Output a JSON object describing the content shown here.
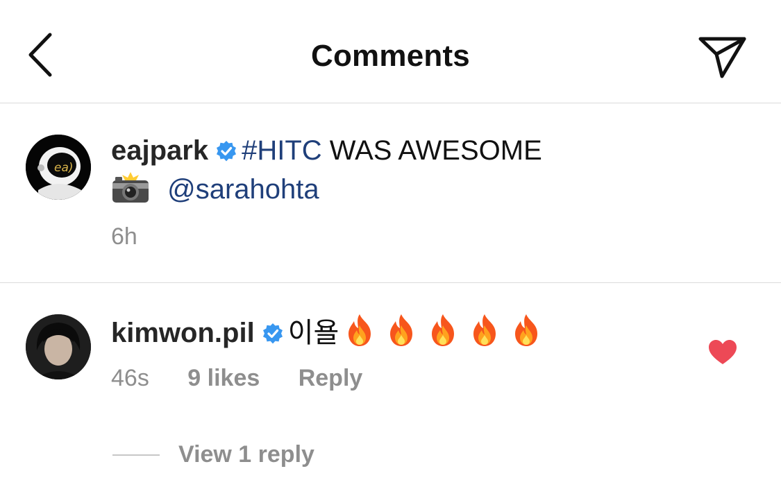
{
  "header": {
    "title": "Comments"
  },
  "caption": {
    "username": "eajpark",
    "hashtag": "#HITC",
    "text": " WAS AWESOME",
    "camera_emoji": "camera-with-flash",
    "mention": "@sarahohta",
    "time": "6h"
  },
  "comment": {
    "username": "kimwon.pil",
    "text": "이욜",
    "emoji_name": "fire",
    "emoji_count": 5,
    "time": "46s",
    "likes": "9 likes",
    "reply_label": "Reply",
    "liked": true,
    "view_replies": "View 1 reply"
  },
  "colors": {
    "verified": "#3897f0",
    "link": "#1f3f7a",
    "heart": "#ed4956",
    "muted": "#8e8e8e"
  }
}
